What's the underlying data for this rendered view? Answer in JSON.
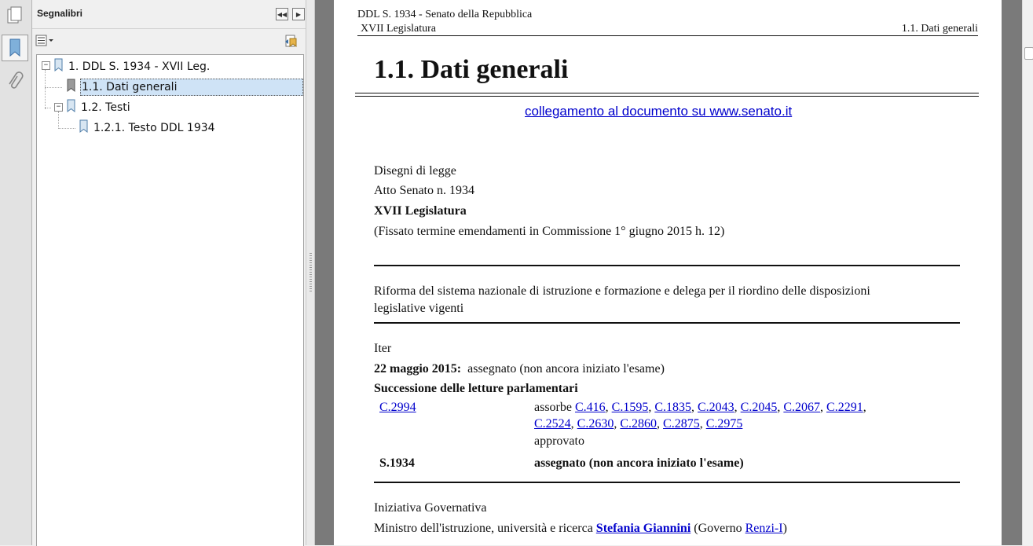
{
  "sidebar": {
    "title": "Segnalibri",
    "tree": [
      {
        "label": "1. DDL S. 1934 - XVII Leg."
      },
      {
        "label": "1.1. Dati generali"
      },
      {
        "label": "1.2. Testi"
      },
      {
        "label": "1.2.1. Testo DDL 1934"
      }
    ]
  },
  "document": {
    "running_header": {
      "line1": "DDL S. 1934 - Senato della Repubblica",
      "left": "XVII Legislatura",
      "right": "1.1. Dati generali"
    },
    "heading": "1.1. Dati generali",
    "link_prefix": "collegamento al documento su ",
    "link_site": "www.senato.it",
    "category": "Disegni di legge",
    "atto": "Atto Senato n. 1934",
    "legislatura": "XVII Legislatura",
    "note": "(Fissato termine emendamenti in Commissione 1° giugno 2015 h. 12)",
    "title_line1": "Riforma del sistema nazionale di istruzione e formazione e delega per il riordino delle disposizioni",
    "title_line2": "legislative vigenti",
    "iter_label": "Iter",
    "iter_date": "22 maggio 2015:",
    "iter_status": "assegnato (non ancora iniziato l'esame)",
    "succession_label": "Successione delle letture parlamentari",
    "reading1": {
      "id": "C.2994",
      "absorbs_label": "assorbe",
      "absorbed": [
        "C.416",
        "C.1595",
        "C.1835",
        "C.2043",
        "C.2045",
        "C.2067",
        "C.2291",
        "C.2524",
        "C.2630",
        "C.2860",
        "C.2875",
        "C.2975"
      ],
      "status": "approvato"
    },
    "reading2": {
      "id": "S.1934",
      "status": "assegnato (non ancora iniziato l'esame)"
    },
    "initiative": "Iniziativa Governativa",
    "minister_prefix": "Ministro dell'istruzione, università e ricerca ",
    "minister_name": "Stefania Giannini",
    "government_prefix": " (Governo ",
    "government": "Renzi-I",
    "government_suffix": ")"
  }
}
